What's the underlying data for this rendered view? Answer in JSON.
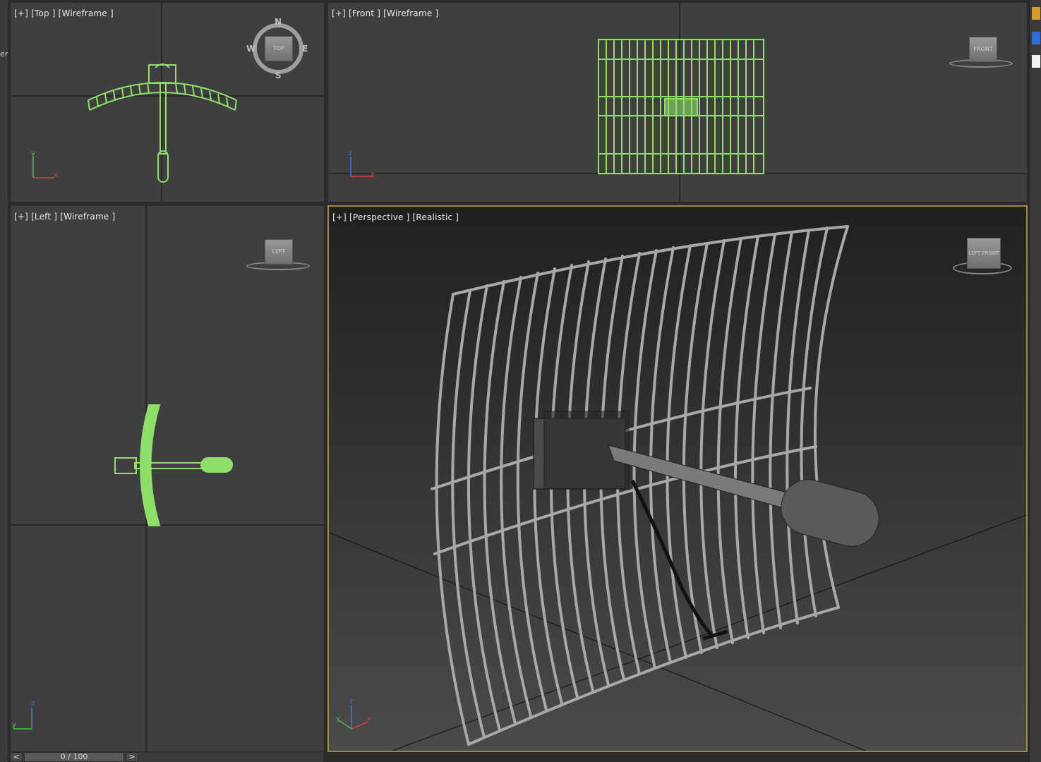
{
  "viewports": {
    "top": {
      "label": "[+] [Top ] [Wireframe ]",
      "viewcube": "TOP"
    },
    "front": {
      "label": "[+] [Front ] [Wireframe ]",
      "viewcube": "FRONT"
    },
    "left": {
      "label": "[+] [Left ] [Wireframe ]",
      "viewcube": "LEFT"
    },
    "persp": {
      "label": "[+] [Perspective ] [Realistic ]",
      "viewcube_left": "LEFT",
      "viewcube_right": "FRONT"
    }
  },
  "compass": {
    "n": "N",
    "s": "S",
    "e": "E",
    "w": "W"
  },
  "axes": {
    "x": "x",
    "y": "y",
    "z": "z"
  },
  "timeline": {
    "prev": "<",
    "next": ">",
    "frame": "0 / 100"
  },
  "left_panel": {
    "fragment": "er"
  },
  "colors": {
    "wireframe": "#8ee06a",
    "viewport_bg": "#3f3f3f",
    "active_border": "#a08a3c",
    "axis_x": "#d04040",
    "axis_y": "#50c050",
    "axis_z": "#4a74d0"
  }
}
